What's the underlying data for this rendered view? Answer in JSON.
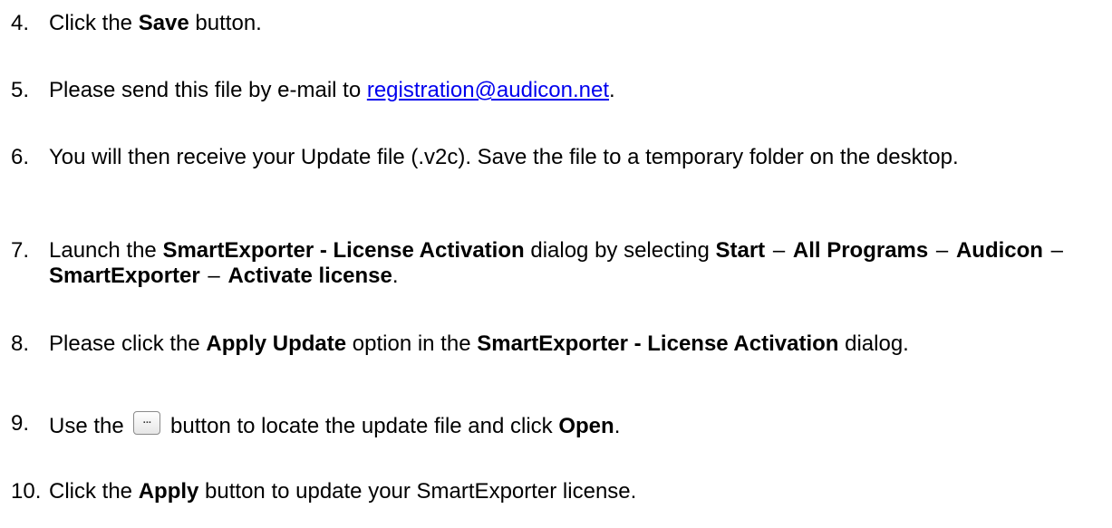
{
  "steps": [
    {
      "num": "4.",
      "t1": "Click the ",
      "b1": "Save",
      "t2": " button."
    },
    {
      "num": "5.",
      "t1": "Please send this file by e-mail to ",
      "email": "registration@audicon.net",
      "t2": "."
    },
    {
      "num": "6.",
      "t1": "You will then receive your Update file (.v2c). Save the file to a temporary folder on the desktop."
    },
    {
      "num": "7.",
      "t1": "Launch the ",
      "b1": "SmartExporter - License Activation",
      "t2": " dialog by selecting ",
      "b2": "Start",
      "d1": "–",
      "b3": "All Programs",
      "d2": "–",
      "b4": "Audicon",
      "d3": "–",
      "b5": "SmartExporter",
      "d4": "–",
      "b6": "Activate license",
      "t3": "."
    },
    {
      "num": "8.",
      "t1": "Please click the ",
      "b1": "Apply Update",
      "t2": " option in the ",
      "b2": "SmartExporter - License Activation",
      "t3": " dialog."
    },
    {
      "num": "9.",
      "t1": "Use the ",
      "button_glyph": "...",
      "t2": " button to locate the update file and click ",
      "b1": "Open",
      "t3": "."
    },
    {
      "num": "10.",
      "t1": "Click the ",
      "b1": "Apply",
      "t2": " button to update your SmartExporter license."
    }
  ],
  "colors": {
    "link": "#0000ee",
    "text": "#000000"
  }
}
